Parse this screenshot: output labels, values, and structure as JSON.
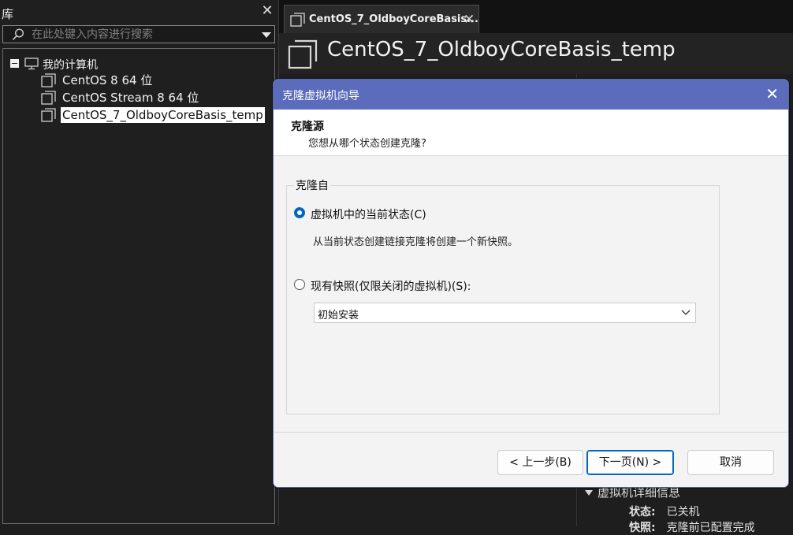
{
  "library": {
    "title": "库",
    "search_placeholder": "在此处键入内容进行搜索",
    "root_label": "我的计算机",
    "items": [
      {
        "label": "CentOS 8 64 位"
      },
      {
        "label": "CentOS Stream 8 64 位"
      },
      {
        "label": "CentOS_7_OldboyCoreBasis_temp",
        "selected": true
      }
    ]
  },
  "tab": {
    "label": "CentOS_7_OldboyCoreBasis..."
  },
  "vm": {
    "title": "CentOS_7_OldboyCoreBasis_temp",
    "details_title": "虚拟机详细信息",
    "details": [
      {
        "key": "状态:",
        "value": "已关机"
      },
      {
        "key": "快照:",
        "value": "克隆前已配置完成"
      }
    ]
  },
  "dialog": {
    "title": "克隆虚拟机向导",
    "heading": "克隆源",
    "subheading": "您想从哪个状态创建克隆?",
    "group_label": "克隆自",
    "option_current": "虚拟机中的当前状态(C)",
    "option_current_desc": "从当前状态创建链接克隆将创建一个新快照。",
    "option_snapshot": "现有快照(仅限关闭的虚拟机)(S):",
    "snapshot_value": "初始安装",
    "back_label": "< 上一步(B)",
    "next_label": "下一页(N) >",
    "cancel_label": "取消"
  },
  "colors": {
    "titlebar": "#5a6cbb",
    "accent": "#0067c0",
    "background": "#1e1e1e"
  },
  "icons": [
    "close-icon",
    "search-icon",
    "dropdown-arrow-icon",
    "computer-icon",
    "vm-icon",
    "chevron-down-icon"
  ]
}
